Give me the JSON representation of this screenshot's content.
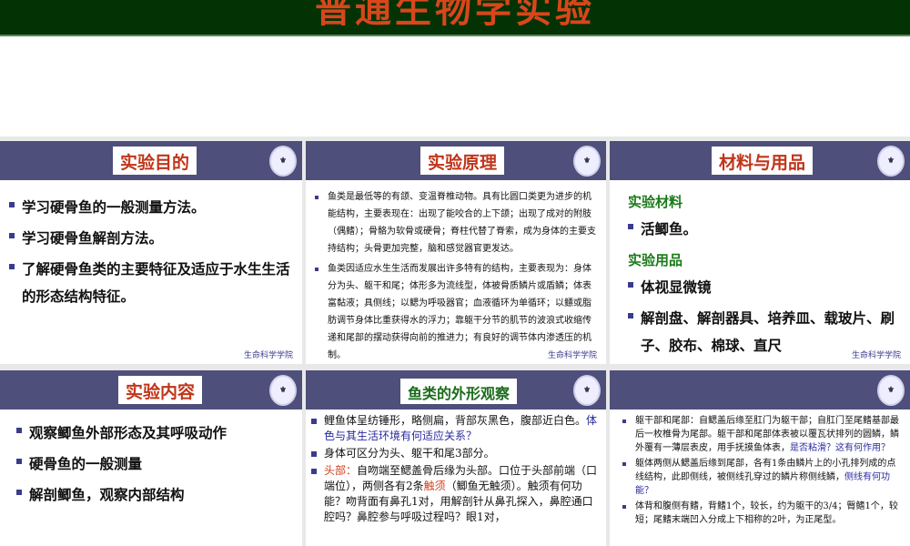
{
  "header": {
    "title": "普通生物学实验"
  },
  "panels": [
    {
      "title": "实验目的",
      "items": [
        "学习硬骨鱼的一般测量方法。",
        "学习硬骨鱼解剖方法。",
        "了解硬骨鱼类的主要特征及适应于水生生活的形态结构特征。"
      ],
      "footer": "生命科学学院"
    },
    {
      "title": "实验原理",
      "items": [
        "鱼类是最低等的有颌、变温脊椎动物。具有比圆口类更为进步的机能结构，主要表现在：出现了能咬合的上下颌；出现了成对的附肢（偶鳍）；骨骼为软骨或硬骨；脊柱代替了脊索，成为身体的主要支持结构；头骨更加完整，脑和感觉器官更发达。",
        "鱼类因适应水生生活而发展出许多特有的结构，主要表现为：身体分为头、躯干和尾；体形多为流线型，体被骨质鳞片或盾鳞；体表富黏液；具侧线；以鳃为呼吸器官；血液循环为单循环；以鳔或脂肪调节身体比重获得水的浮力；靠躯干分节的肌节的波浪式收缩传递和尾部的摆动获得向前的推进力；有良好的调节体内渗透压的机制。"
      ],
      "footer": "生命科学学院"
    },
    {
      "title": "材料与用品",
      "heading1": "实验材料",
      "items1": [
        "活鲫鱼。"
      ],
      "heading2": "实验用品",
      "items2": [
        "体视显微镜",
        "解剖盘、解剖器具、培养皿、载玻片、刷子、胶布、棉球、直尺"
      ],
      "footer": "生命科学学院"
    },
    {
      "title": "实验内容",
      "items": [
        "观察鲫鱼外部形态及其呼吸动作",
        "硬骨鱼的一般测量",
        "解剖鲫鱼，观察内部结构"
      ]
    },
    {
      "title": "鱼类的外形观察",
      "item1": "鲤鱼体呈纺锤形，略侧扁，背部灰黑色，腹部近白色。",
      "item1_q": "体色与其生活环境有何适应关系？",
      "item2": "身体可区分为头、躯干和尾3部分。",
      "item3_label": "头部：",
      "item3_a": "自吻端至鳃盖骨后缘为头部。口位于头部前端（口端位），两侧各有2条",
      "item3_red": "触须",
      "item3_b": "（鲫鱼无触须）。触须有何功能？吻背面有鼻孔1对，用解剖针从鼻孔探入，鼻腔通口腔吗？鼻腔参与呼吸过程吗？眼1对，"
    },
    {
      "item1": "躯干部和尾部：自鳃盖后缘至肛门为躯干部；自肛门至尾鳍基部最后一枚椎骨为尾部。躯干部和尾部体表被以覆瓦状排列的圆鳞，鳞外覆有一薄层表皮，用手抚摸鱼体表，",
      "item1_q": "是否粘滑？这有何作用？",
      "item2": "躯体两侧从鳃盖后缘到尾部，各有1条由鳞片上的小孔排列成的点线结构，此即侧线，被侧线孔穿过的鳞片称侧线鳞，",
      "item2_q": "侧线有何功能？",
      "item3": "体背和腹侧有鳍，背鳍1个，较长，约为躯干的3/4；臀鳍1个，较短；尾鳍末端凹入分成上下相称的2叶，为正尾型。"
    }
  ]
}
